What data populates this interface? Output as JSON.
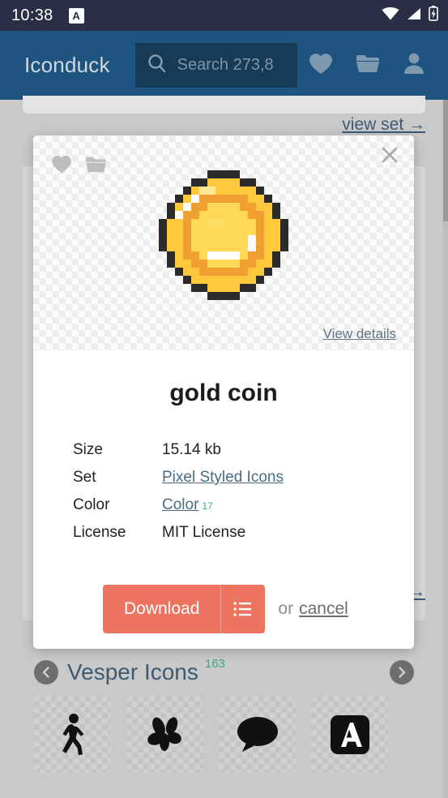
{
  "status_bar": {
    "time": "10:38",
    "app_badge": "A",
    "icons": [
      "wifi-icon",
      "cell-signal-icon",
      "battery-charging-icon"
    ]
  },
  "header": {
    "brand": "Iconduck",
    "search": {
      "placeholder": "Search 273,8"
    },
    "nav_icons": [
      {
        "name": "favorites-heart-icon",
        "label": "Favorites"
      },
      {
        "name": "collections-folder-icon",
        "label": "Collections"
      },
      {
        "name": "account-user-icon",
        "label": "Account"
      }
    ]
  },
  "background": {
    "view_set_link": "view set →",
    "view_set_link_2": "view set →"
  },
  "modal": {
    "close_label": "×",
    "top_icons": [
      {
        "name": "favorite-heart-icon",
        "label": "Favorite"
      },
      {
        "name": "add-to-collection-folder-icon",
        "label": "Add to collection"
      }
    ],
    "preview_icon": "gold-coin-pixel-art",
    "view_details_link": "View details",
    "title": "gold coin",
    "meta": [
      {
        "key": "Size",
        "value": "15.14 kb",
        "link": false,
        "sup": ""
      },
      {
        "key": "Set",
        "value": "Pixel Styled Icons",
        "link": true,
        "sup": ""
      },
      {
        "key": "Color",
        "value": "Color",
        "link": true,
        "sup": "17"
      },
      {
        "key": "License",
        "value": "MIT License",
        "link": false,
        "sup": ""
      }
    ],
    "download_label": "Download",
    "download_menu_icon": "list-menu-icon",
    "or_text": "or",
    "cancel_label": "cancel"
  },
  "set_strip": {
    "prev_icon": "chevron-left-circle-icon",
    "next_icon": "chevron-right-circle-icon",
    "title": "Vesper Icons",
    "count": "163",
    "icons": [
      {
        "name": "walking-person-icon"
      },
      {
        "name": "butterfly-icon"
      },
      {
        "name": "speech-bubble-icon"
      },
      {
        "name": "letter-a-square-icon"
      }
    ]
  },
  "colors": {
    "status_bar_bg": "#2b2e45",
    "header_bg": "#1f5480",
    "search_bg": "#173b57",
    "page_bg": "#c9c9c9",
    "accent_download": "#ec7461",
    "link_blue": "#3d5a72",
    "count_green": "#3aa88b",
    "coin_light": "#ffd955",
    "coin_mid": "#ffc83d",
    "coin_dark": "#f0a030",
    "coin_outline": "#2b2b2b"
  }
}
